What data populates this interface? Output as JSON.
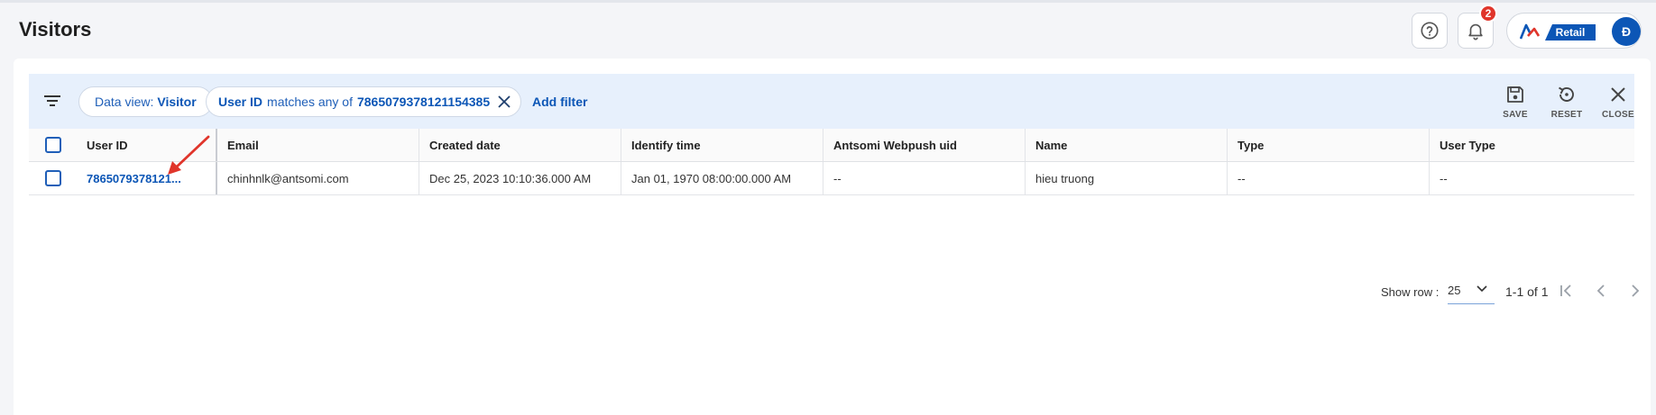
{
  "header": {
    "title": "Visitors",
    "notifications_count": "2",
    "brand_tag": "Retail",
    "avatar_initial": "Đ"
  },
  "toolbar": {
    "data_view_label": "Data view:",
    "data_view_value": "Visitor",
    "filter_field": "User ID",
    "filter_operator": "matches any of",
    "filter_value": "7865079378121154385",
    "add_filter_label": "Add filter",
    "save_label": "SAVE",
    "reset_label": "RESET",
    "close_label": "CLOSE"
  },
  "table": {
    "columns": [
      "User ID",
      "Email",
      "Created date",
      "Identify time",
      "Antsomi Webpush uid",
      "Name",
      "Type",
      "User Type"
    ],
    "rows": [
      {
        "user_id": "7865079378121...",
        "email": "chinhnlk@antsomi.com",
        "created_date": "Dec 25, 2023 10:10:36.000 AM",
        "identify_time": "Jan 01, 1970 08:00:00.000 AM",
        "webpush_uid": "--",
        "name": "hieu truong",
        "type": "--",
        "user_type": "--"
      }
    ]
  },
  "pagination": {
    "show_row_label": "Show row :",
    "rows_per_page": "25",
    "range_text": "1-1 of 1"
  },
  "colors": {
    "accent": "#0c56b6",
    "toolbar_bg": "#e7f0fc",
    "badge": "#e0352b",
    "annotation_arrow": "#e0352b"
  }
}
